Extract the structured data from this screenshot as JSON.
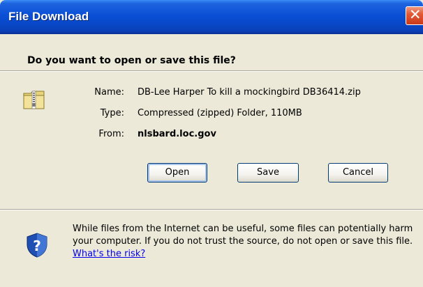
{
  "window": {
    "title": "File Download"
  },
  "prompt": "Do you want to open or save this file?",
  "file": {
    "name_label": "Name:",
    "name_value": "DB-Lee Harper To kill a mockingbird DB36414.zip",
    "type_label": "Type:",
    "type_value": "Compressed (zipped) Folder, 110MB",
    "from_label": "From:",
    "from_value": "nlsbard.loc.gov",
    "icon": "zip-folder-icon"
  },
  "buttons": {
    "open": "Open",
    "save": "Save",
    "cancel": "Cancel"
  },
  "warning": {
    "text_before": "While files from the Internet can be useful, some files can potentially harm your computer. If you do not trust the source, do not open or save this file. ",
    "link": "What's the risk?",
    "icon": "shield-question-icon"
  },
  "colors": {
    "title_bar": "#0a4fd6",
    "close_button": "#e35a36",
    "dialog_bg": "#ece9d8",
    "link": "#0000ee"
  }
}
